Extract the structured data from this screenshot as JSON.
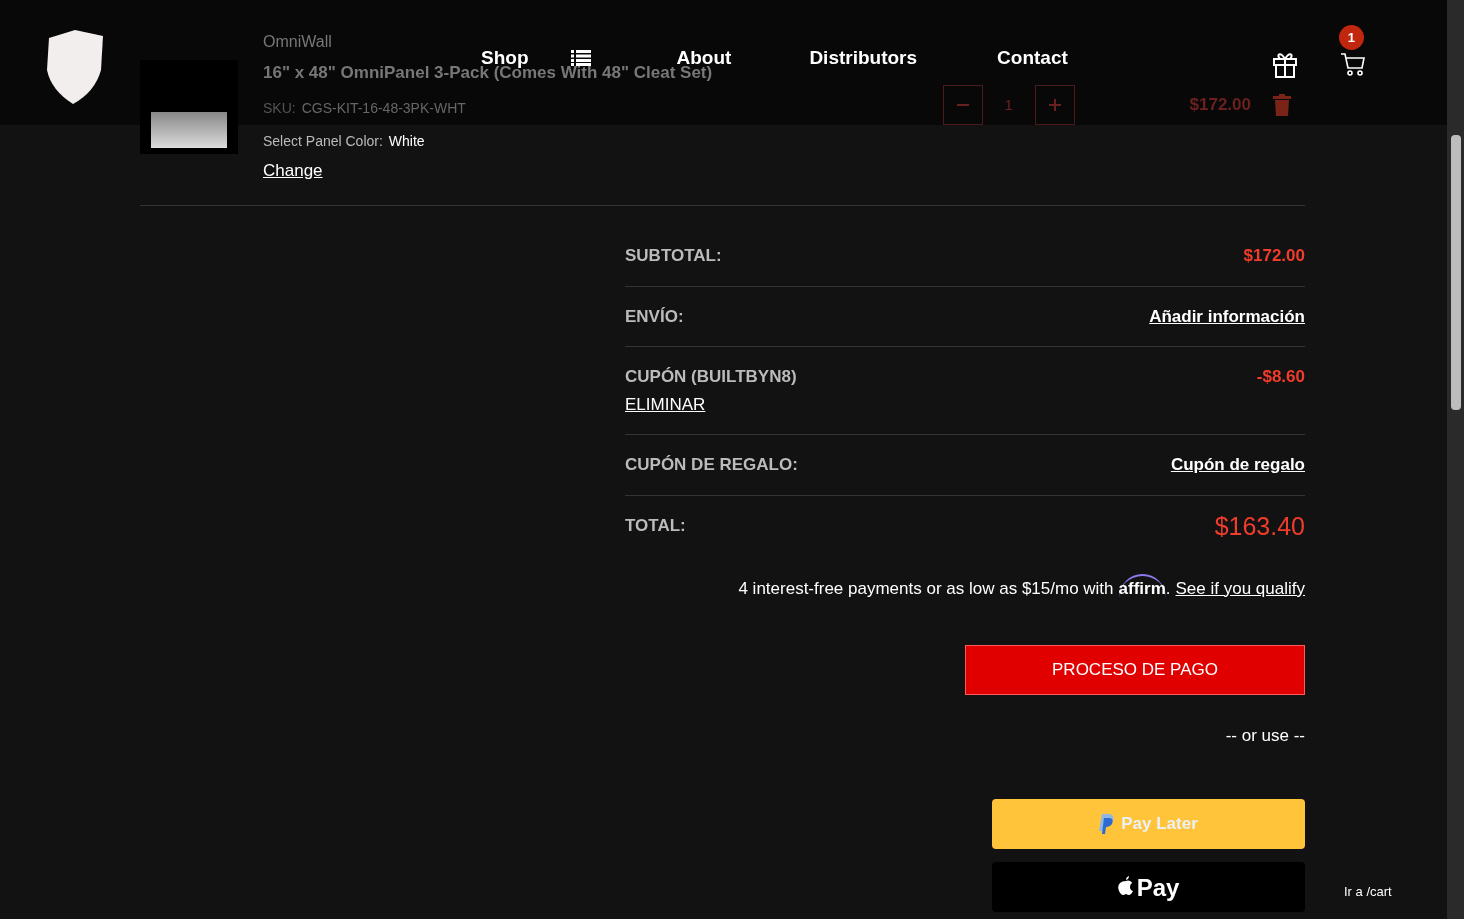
{
  "header": {
    "nav": [
      "Shop",
      "About",
      "Distributors",
      "Contact"
    ],
    "cart_count": "1"
  },
  "product": {
    "brand": "OmniWall",
    "title": "16\" x 48\" OmniPanel 3-Pack (Comes With 48\" Cleat Set)",
    "sku_label": "SKU:",
    "sku": "CGS-KIT-16-48-3PK-WHT",
    "color_label": "Select Panel Color:",
    "color_name": "White",
    "change": "Change",
    "quantity": "1",
    "price": "$172.00"
  },
  "summary": [
    {
      "label": "SUBTOTAL:",
      "kind": "amount",
      "value": "$172.00"
    },
    {
      "label": "ENVÍO:",
      "kind": "link",
      "value": "Añadir información"
    },
    {
      "label": "CUPÓN (BUILTBYN8)",
      "kind": "amount",
      "value": "-$8.60",
      "action": "ELIMINAR"
    },
    {
      "label": "CUPÓN DE REGALO:",
      "kind": "link",
      "value": "Cupón de regalo"
    },
    {
      "label": "TOTAL:",
      "kind": "total",
      "value": "$163.40"
    }
  ],
  "affirm": {
    "text": "4 interest-free payments or as low as $15/mo with",
    "brand": "affirm",
    "period": ".",
    "link": "See if you qualify"
  },
  "checkout_button": "PROCESO DE PAGO",
  "or_use": "-- or use --",
  "paylater": "Pay Later",
  "applepay": "Pay",
  "goto": "Ir a /cart"
}
